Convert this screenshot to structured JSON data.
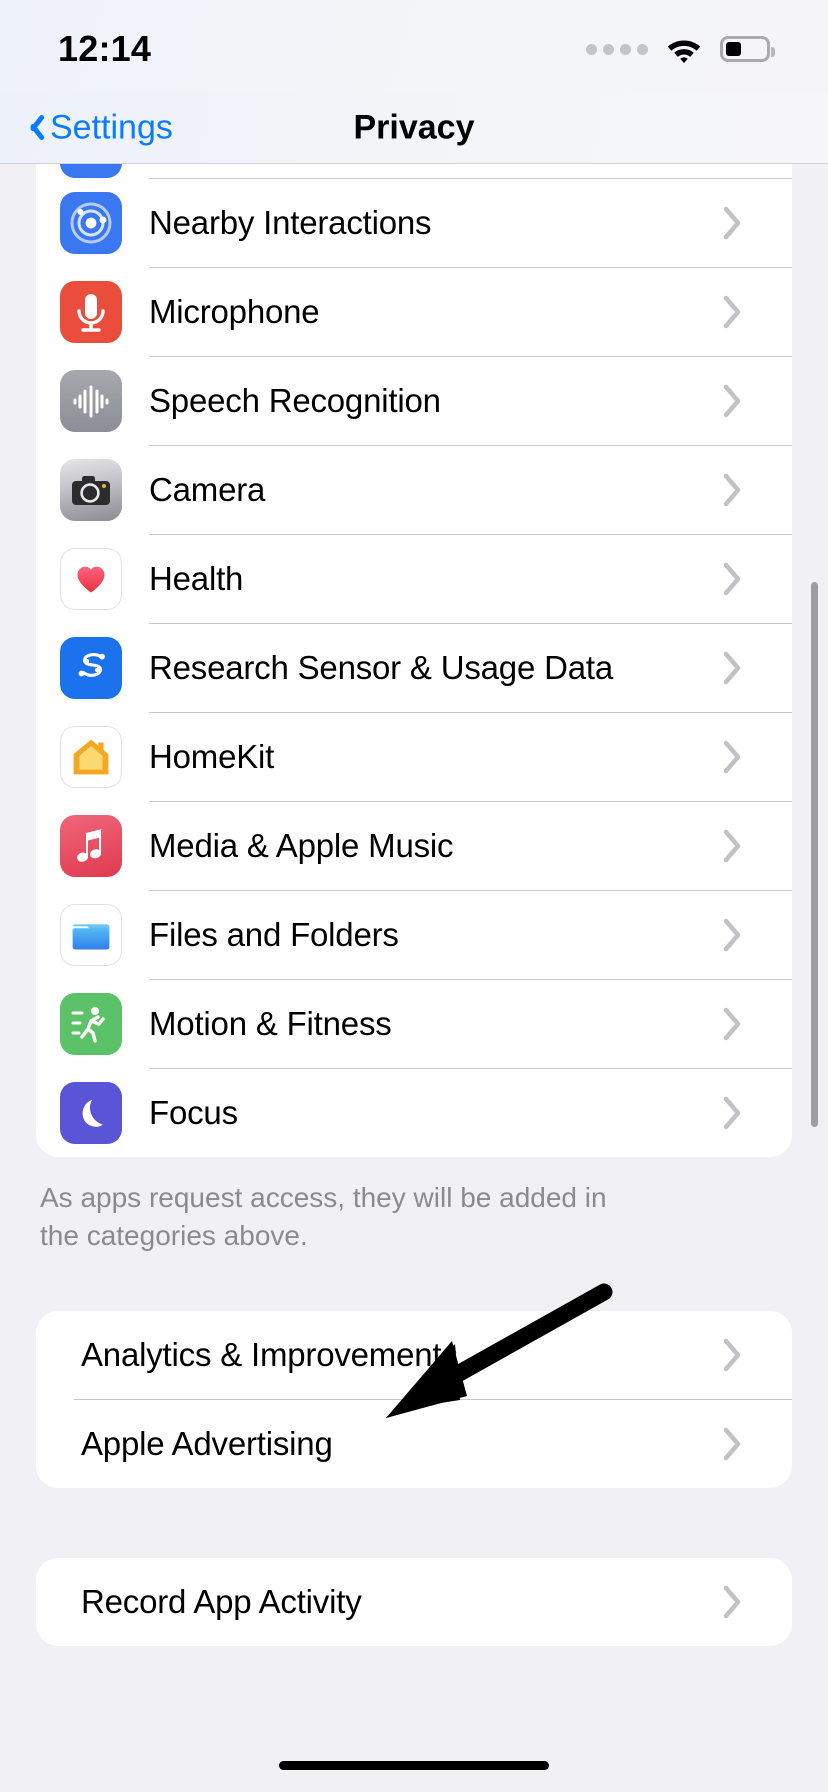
{
  "status_bar": {
    "time": "12:14",
    "signal_icon": "cellular-dots-icon",
    "wifi_icon": "wifi-icon",
    "battery_icon": "battery-icon",
    "battery_level_percent": 40
  },
  "nav": {
    "back_label": "Settings",
    "back_icon": "chevron-left-icon",
    "title": "Privacy"
  },
  "colors": {
    "accent": "#0a7cff",
    "page_background": "#f1f1f5",
    "card_background": "#ffffff",
    "separator": "#c9c9cc",
    "footnote_text": "#8a8a8f",
    "chevron": "#c2c2c6"
  },
  "privacy_group": {
    "items": [
      {
        "label": "Nearby Interactions",
        "icon": "nearby-interactions-icon",
        "icon_color": "#3a78f2",
        "chevron": "chevron-right-icon"
      },
      {
        "label": "Microphone",
        "icon": "microphone-icon",
        "icon_color": "#eb4d3d",
        "chevron": "chevron-right-icon"
      },
      {
        "label": "Speech Recognition",
        "icon": "speech-recognition-icon",
        "icon_color": "#9a9aa1",
        "chevron": "chevron-right-icon"
      },
      {
        "label": "Camera",
        "icon": "camera-icon",
        "icon_color": "#8e8e93",
        "chevron": "chevron-right-icon"
      },
      {
        "label": "Health",
        "icon": "health-heart-icon",
        "icon_color": "#ffffff",
        "chevron": "chevron-right-icon"
      },
      {
        "label": "Research Sensor & Usage Data",
        "icon": "research-sensor-icon",
        "icon_color": "#1b72ec",
        "chevron": "chevron-right-icon"
      },
      {
        "label": "HomeKit",
        "icon": "homekit-house-icon",
        "icon_color": "#ffffff",
        "chevron": "chevron-right-icon"
      },
      {
        "label": "Media & Apple Music",
        "icon": "apple-music-icon",
        "icon_color": "#e8566a",
        "chevron": "chevron-right-icon"
      },
      {
        "label": "Files and Folders",
        "icon": "files-folder-icon",
        "icon_color": "#ffffff",
        "chevron": "chevron-right-icon"
      },
      {
        "label": "Motion & Fitness",
        "icon": "motion-fitness-icon",
        "icon_color": "#5cc26a",
        "chevron": "chevron-right-icon"
      },
      {
        "label": "Focus",
        "icon": "focus-moon-icon",
        "icon_color": "#5a55d6",
        "chevron": "chevron-right-icon"
      }
    ],
    "footnote": "As apps request access, they will be added in the categories above."
  },
  "analytics_group": {
    "items": [
      {
        "label": "Analytics & Improvements",
        "chevron": "chevron-right-icon"
      },
      {
        "label": "Apple Advertising",
        "chevron": "chevron-right-icon"
      }
    ]
  },
  "record_group": {
    "items": [
      {
        "label": "Record App Activity",
        "chevron": "chevron-right-icon"
      }
    ]
  },
  "annotation": {
    "arrow_icon": "annotation-arrow-icon",
    "arrow_color": "#000000",
    "points_to": "Record App Activity"
  },
  "home_indicator": "home-indicator"
}
